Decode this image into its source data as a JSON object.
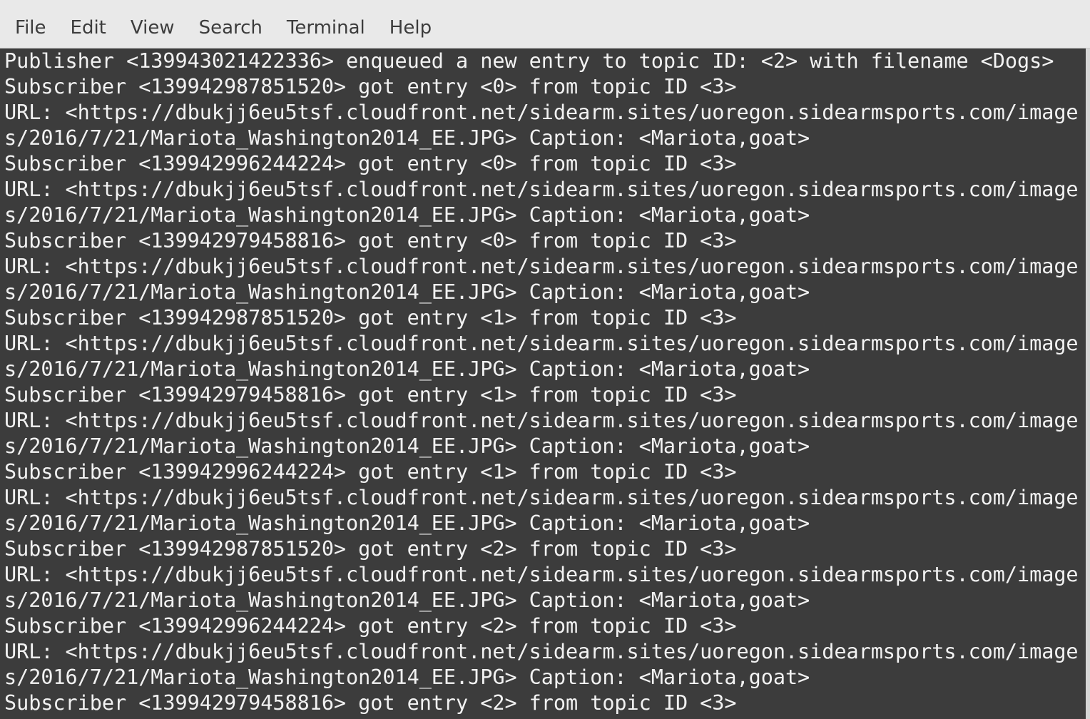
{
  "menubar": {
    "items": [
      "File",
      "Edit",
      "View",
      "Search",
      "Terminal",
      "Help"
    ]
  },
  "terminal": {
    "lines": [
      "Publisher <139943021422336> enqueued a new entry to topic ID: <2> with filename <Dogs>",
      "Subscriber <139942987851520> got entry <0> from topic ID <3>",
      "URL: <https://dbukjj6eu5tsf.cloudfront.net/sidearm.sites/uoregon.sidearmsports.com/image",
      "s/2016/7/21/Mariota_Washington2014_EE.JPG> Caption: <Mariota,goat>",
      "Subscriber <139942996244224> got entry <0> from topic ID <3>",
      "URL: <https://dbukjj6eu5tsf.cloudfront.net/sidearm.sites/uoregon.sidearmsports.com/image",
      "s/2016/7/21/Mariota_Washington2014_EE.JPG> Caption: <Mariota,goat>",
      "Subscriber <139942979458816> got entry <0> from topic ID <3>",
      "URL: <https://dbukjj6eu5tsf.cloudfront.net/sidearm.sites/uoregon.sidearmsports.com/image",
      "s/2016/7/21/Mariota_Washington2014_EE.JPG> Caption: <Mariota,goat>",
      "Subscriber <139942987851520> got entry <1> from topic ID <3>",
      "URL: <https://dbukjj6eu5tsf.cloudfront.net/sidearm.sites/uoregon.sidearmsports.com/image",
      "s/2016/7/21/Mariota_Washington2014_EE.JPG> Caption: <Mariota,goat>",
      "Subscriber <139942979458816> got entry <1> from topic ID <3>",
      "URL: <https://dbukjj6eu5tsf.cloudfront.net/sidearm.sites/uoregon.sidearmsports.com/image",
      "s/2016/7/21/Mariota_Washington2014_EE.JPG> Caption: <Mariota,goat>",
      "Subscriber <139942996244224> got entry <1> from topic ID <3>",
      "URL: <https://dbukjj6eu5tsf.cloudfront.net/sidearm.sites/uoregon.sidearmsports.com/image",
      "s/2016/7/21/Mariota_Washington2014_EE.JPG> Caption: <Mariota,goat>",
      "Subscriber <139942987851520> got entry <2> from topic ID <3>",
      "URL: <https://dbukjj6eu5tsf.cloudfront.net/sidearm.sites/uoregon.sidearmsports.com/image",
      "s/2016/7/21/Mariota_Washington2014_EE.JPG> Caption: <Mariota,goat>",
      "Subscriber <139942996244224> got entry <2> from topic ID <3>",
      "URL: <https://dbukjj6eu5tsf.cloudfront.net/sidearm.sites/uoregon.sidearmsports.com/image",
      "s/2016/7/21/Mariota_Washington2014_EE.JPG> Caption: <Mariota,goat>",
      "Subscriber <139942979458816> got entry <2> from topic ID <3>"
    ]
  }
}
